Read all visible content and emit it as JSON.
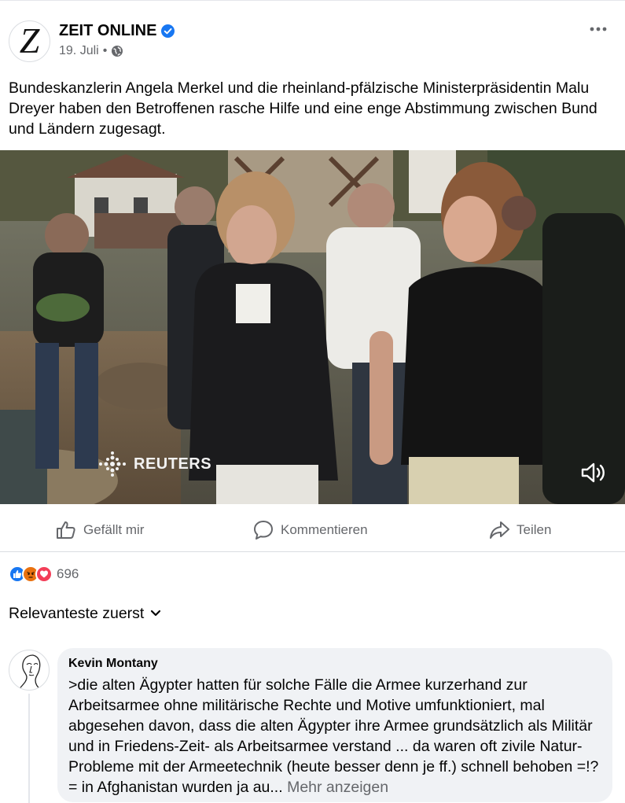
{
  "post": {
    "page_name": "ZEIT ONLINE",
    "avatar_letter": "Z",
    "date": "19. Juli",
    "separator": "•",
    "text": "Bundeskanzlerin Angela Merkel und die rheinland-pfälzische Ministerpräsidentin Malu Dreyer haben den Betroffenen rasche Hilfe und eine enge Abstimmung zwischen Bund und Ländern zugesagt.",
    "video_watermark": "REUTERS"
  },
  "actions": {
    "like": "Gefällt mir",
    "comment": "Kommentieren",
    "share": "Teilen"
  },
  "reactions": {
    "count": "696",
    "types": [
      "like-icon",
      "angry-icon",
      "love-icon"
    ],
    "colors": {
      "like": "#1877f2",
      "angry": "#e9710f",
      "love": "#f33e58"
    }
  },
  "sort": {
    "label": "Relevanteste zuerst"
  },
  "comment": {
    "author": "Kevin Montany",
    "text": ">die alten Ägypter hatten für solche Fälle die Armee kurzerhand zur Arbeitsarmee ohne militärische Rechte  und Motive umfunktioniert, mal abgesehen davon, dass die alten Ägypter ihre Armee grundsätzlich als Militär und in Friedens-Zeit- als Arbeitsarmee verstand  ... da waren oft zivile Natur-Probleme mit der Armeetechnik (heute  besser denn je ff.) schnell behoben =!?= in Afghanistan wurden ja au...",
    "more": "Mehr anzeigen"
  },
  "colors": {
    "accent": "#1877f2",
    "secondary_text": "#65676b",
    "bubble_bg": "#f0f2f5"
  }
}
